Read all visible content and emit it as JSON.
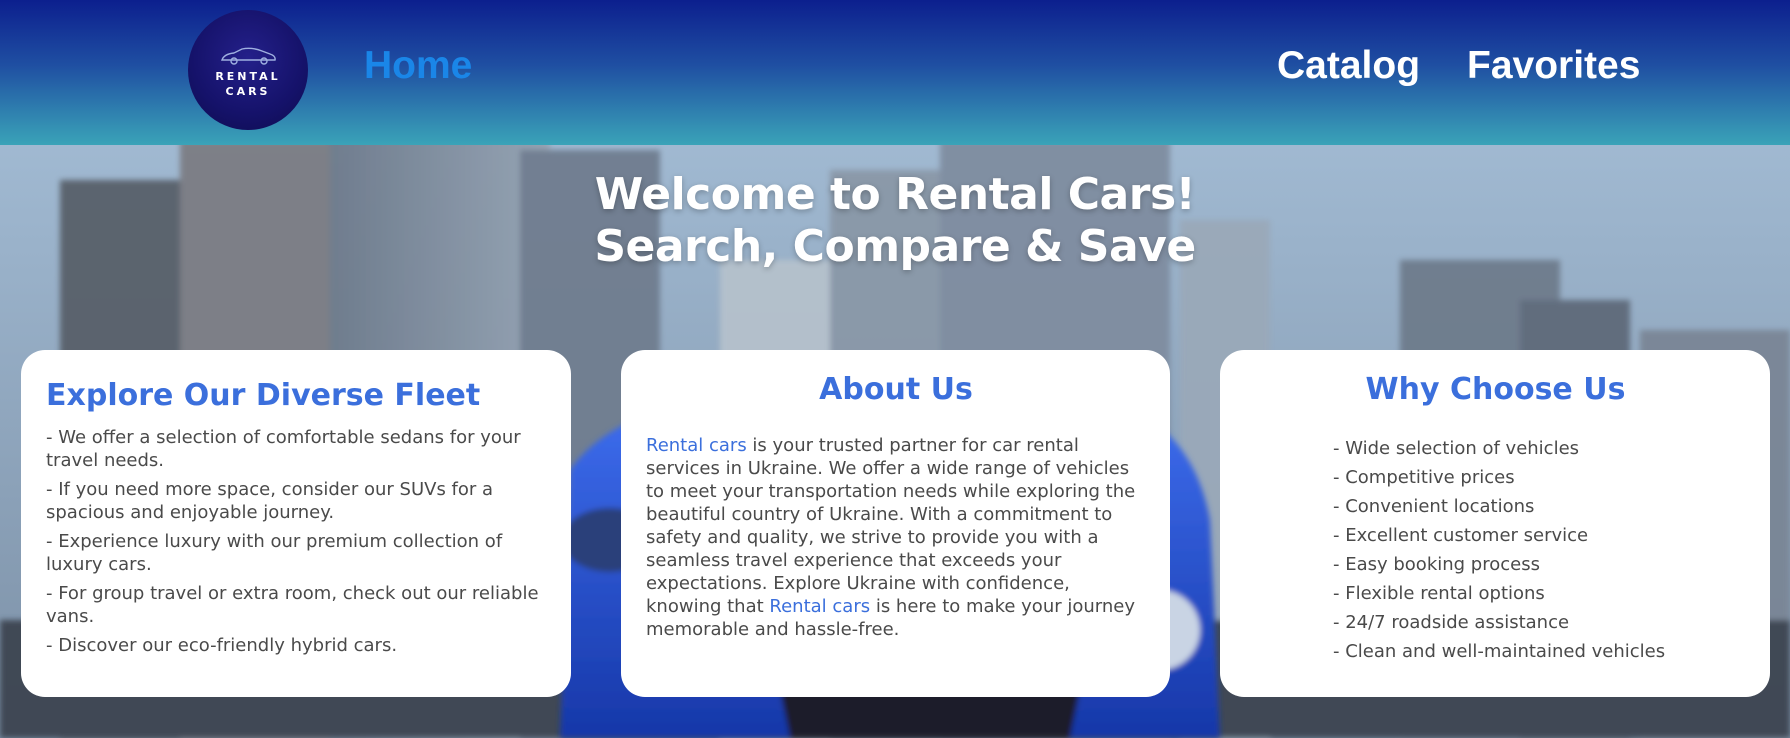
{
  "header": {
    "logo": {
      "line1": "RENTAL",
      "line2": "CARS",
      "icon": "car-icon"
    },
    "nav": {
      "home": "Home",
      "catalog": "Catalog",
      "favorites": "Favorites"
    },
    "colors": {
      "active_link": "#1a86e8",
      "gradient_top": "#0c1f8e",
      "gradient_bottom": "#3aa3b8"
    }
  },
  "hero": {
    "line1": "Welcome to Rental Cars!",
    "line2": "Search, Compare & Save"
  },
  "cards": {
    "fleet": {
      "title": "Explore Our Diverse Fleet",
      "items": [
        "- We offer a selection of comfortable sedans for your travel needs.",
        "- If you need more space, consider our SUVs for a spacious and enjoyable journey.",
        "- Experience luxury with our premium collection of luxury cars.",
        "- For group travel or extra room, check out our reliable vans.",
        "- Discover our eco-friendly hybrid cars."
      ]
    },
    "about": {
      "title": "About Us",
      "link1": "Rental cars",
      "text1": " is your trusted partner for car rental services in Ukraine. We offer a wide range of vehicles to meet your transportation needs while exploring the beautiful country of Ukraine. With a commitment to safety and quality, we strive to provide you with a seamless travel experience that exceeds your expectations. Explore Ukraine with confidence, knowing that ",
      "link2": "Rental cars",
      "text2": " is here to make your journey memorable and hassle-free."
    },
    "why": {
      "title": "Why Choose Us",
      "items": [
        "- Wide selection of vehicles",
        "- Competitive prices",
        "- Convenient locations",
        "- Excellent customer service",
        "- Easy booking process",
        "- Flexible rental options",
        "- 24/7 roadside assistance",
        "- Clean and well-maintained vehicles"
      ]
    },
    "colors": {
      "title": "#3b6fdc",
      "body_text": "#4a4a4a"
    }
  }
}
